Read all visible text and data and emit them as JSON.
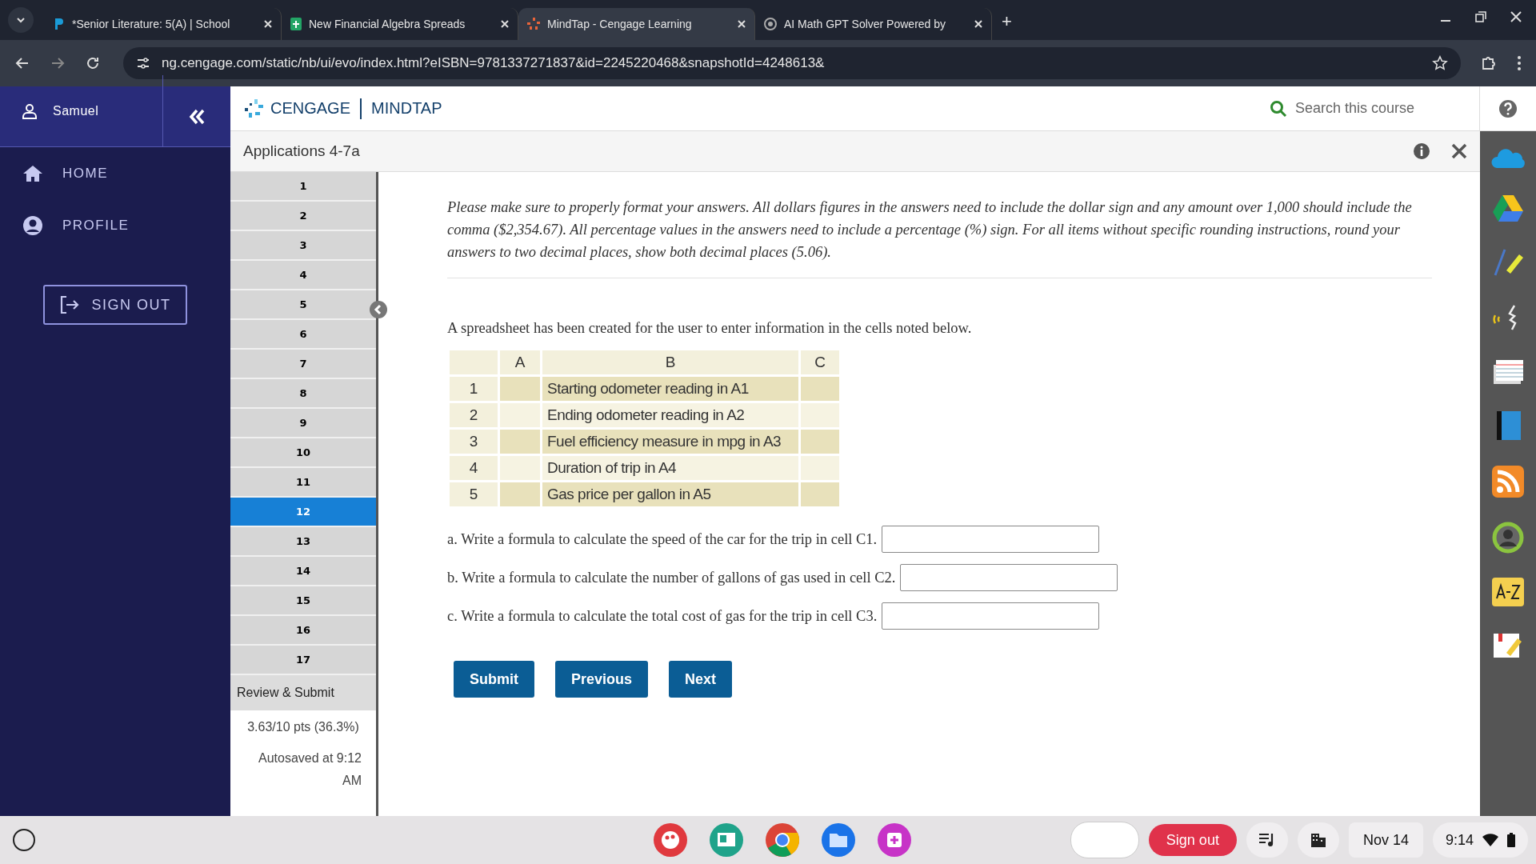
{
  "browser": {
    "tabs": [
      {
        "title": "*Senior Literature: 5(A) | School",
        "selected": false
      },
      {
        "title": "New Financial Algebra Spreads",
        "selected": false
      },
      {
        "title": "MindTap - Cengage Learning",
        "selected": true
      },
      {
        "title": "AI Math GPT Solver Powered by",
        "selected": false
      }
    ],
    "new_tab": "+",
    "address": "ng.cengage.com/static/nb/ui/evo/index.html?eISBN=9781337271837&id=2245220468&snapshotId=4248613&"
  },
  "sidebar": {
    "user": "Samuel",
    "items": [
      {
        "label": "HOME",
        "kind": "home"
      },
      {
        "label": "PROFILE",
        "kind": "profile"
      }
    ],
    "sign_out": "SIGN OUT"
  },
  "header": {
    "brand": "CENGAGE",
    "product": "MINDTAP",
    "search": {
      "placeholder": "Search this course"
    }
  },
  "assignment": {
    "title": "Applications 4-7a"
  },
  "question_nav": {
    "items": [
      {
        "label": "1",
        "selected": false
      },
      {
        "label": "2",
        "selected": false
      },
      {
        "label": "3",
        "selected": false
      },
      {
        "label": "4",
        "selected": false
      },
      {
        "label": "5",
        "selected": false
      },
      {
        "label": "6",
        "selected": false
      },
      {
        "label": "7",
        "selected": false
      },
      {
        "label": "8",
        "selected": false
      },
      {
        "label": "9",
        "selected": false
      },
      {
        "label": "10",
        "selected": false
      },
      {
        "label": "11",
        "selected": false
      },
      {
        "label": "12",
        "selected": true
      },
      {
        "label": "13",
        "selected": false
      },
      {
        "label": "14",
        "selected": false
      },
      {
        "label": "15",
        "selected": false
      },
      {
        "label": "16",
        "selected": false
      },
      {
        "label": "17",
        "selected": false
      }
    ],
    "review": "Review & Submit",
    "score": "3.63/10 pts (36.3%)",
    "autosaved": "Autosaved at 9:12 AM"
  },
  "content": {
    "instructions": "Please make sure to properly format your answers. All dollars figures in the answers need to include the dollar sign and any amount over 1,000 should include the comma ($2,354.67). All percentage values in the answers need to include a percentage (%) sign. For all items without specific rounding instructions, round your answers to two decimal places, show both decimal places (5.06).",
    "intro": "A spreadsheet has been created for the user to enter information in the cells noted below.",
    "spreadsheet": {
      "columns": [
        "A",
        "B",
        "C"
      ],
      "rows": [
        {
          "number": "1",
          "b": "Starting odometer reading in A1"
        },
        {
          "number": "2",
          "b": "Ending odometer reading in A2"
        },
        {
          "number": "3",
          "b": "Fuel efficiency measure in mpg in A3"
        },
        {
          "number": "4",
          "b": "Duration of trip in A4"
        },
        {
          "number": "5",
          "b": "Gas price per gallon in A5"
        }
      ]
    },
    "questions": [
      {
        "text": "a. Write a formula to calculate the speed of the car for the trip in cell C1."
      },
      {
        "text": "b. Write a formula to calculate the number of gallons of gas used in cell C2."
      },
      {
        "text": "c. Write a formula to calculate the total cost of gas for the trip in cell C3."
      }
    ],
    "buttons": [
      "Submit",
      "Previous",
      "Next"
    ]
  },
  "taskbar": {
    "sign_out": "Sign out",
    "date": "Nov 14",
    "time": "9:14"
  }
}
